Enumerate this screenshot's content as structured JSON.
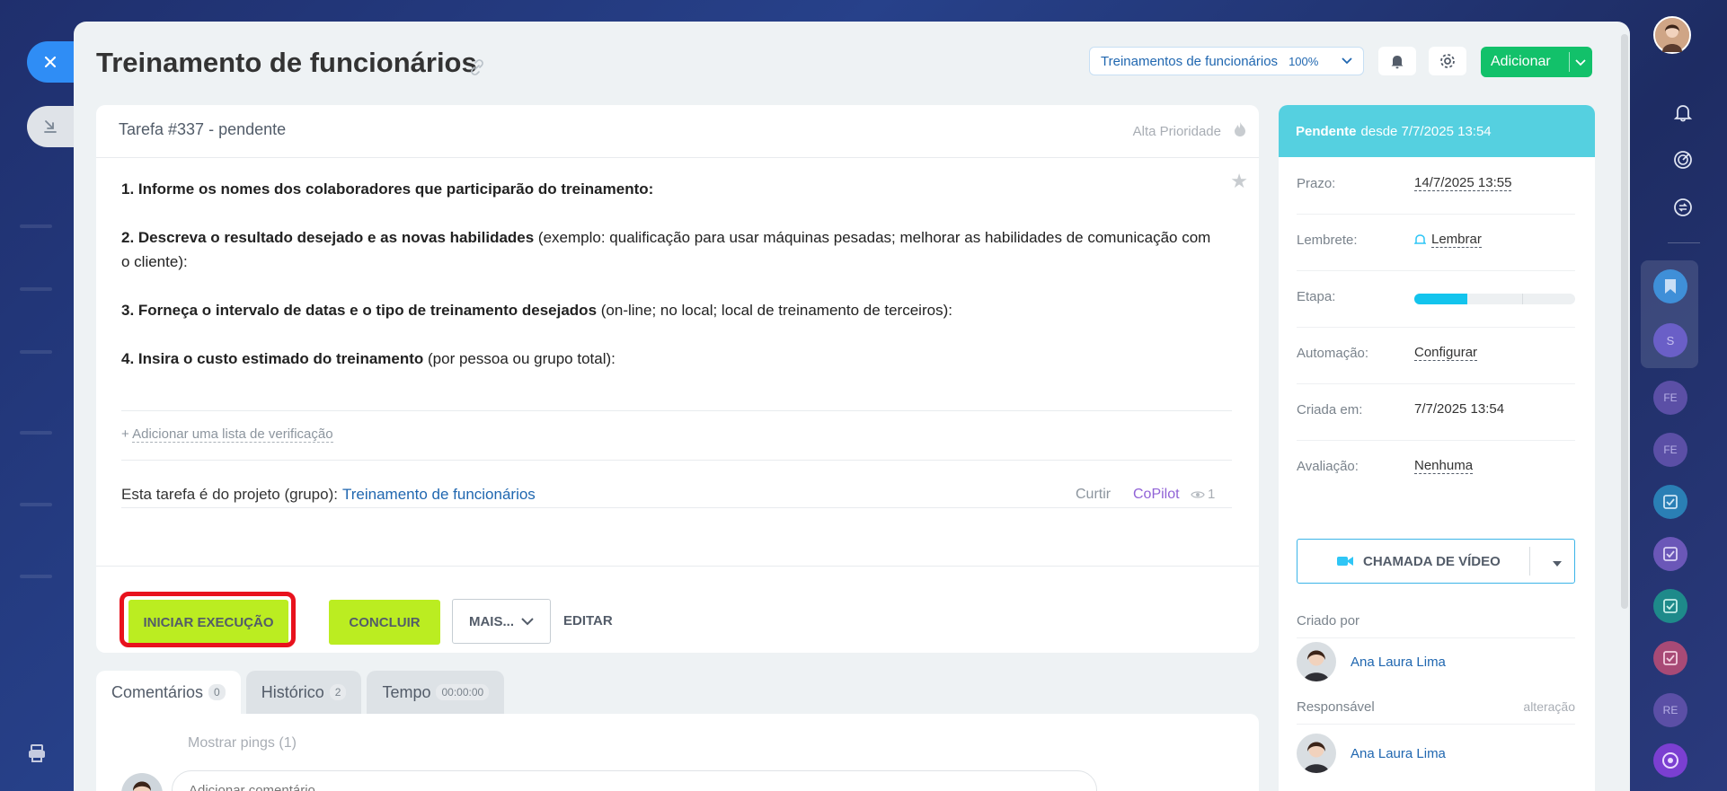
{
  "header": {
    "title": "Treinamento de funcionários",
    "project_select": {
      "name": "Treinamentos de funcionários",
      "percent": "100%"
    },
    "add_label": "Adicionar"
  },
  "task": {
    "number_status": "Tarefa #337 - pendente",
    "priority": "Alta Prioridade",
    "description": [
      {
        "bold": "1. Informe os nomes dos colaboradores que participarão do treinamento:",
        "rest": ""
      },
      {
        "bold": "2. Descreva o resultado desejado e as novas habilidades",
        "rest": " (exemplo: qualificação para usar máquinas pesadas; melhorar as habilidades de comunicação com o cliente):"
      },
      {
        "bold": "3. Forneça o intervalo de datas e o tipo de treinamento desejados",
        "rest": " (on-line; no local; local de treinamento de terceiros):"
      },
      {
        "bold": "4. Insira o custo estimado do treinamento",
        "rest": " (por pessoa ou grupo total):"
      }
    ],
    "checklist_prefix": "+",
    "checklist_add": "Adicionar uma lista de verificação",
    "project_prefix": "Esta tarefa é do projeto (grupo):",
    "project_link": "Treinamento de funcionários",
    "like": "Curtir",
    "copilot": "CoPilot",
    "views": "1"
  },
  "actions": {
    "start": "INICIAR EXECUÇÃO",
    "conclude": "CONCLUIR",
    "more": "MAIS...",
    "edit": "EDITAR"
  },
  "tabs": [
    {
      "label": "Comentários",
      "count": "0"
    },
    {
      "label": "Histórico",
      "count": "2"
    },
    {
      "label": "Tempo",
      "count": "00:00:00"
    }
  ],
  "comments": {
    "show_pings": "Mostrar pings (1)",
    "placeholder": "Adicionar comentário..."
  },
  "sidebar": {
    "status_label": "Pendente",
    "status_since": "desde 7/7/2025 13:54",
    "deadline_label": "Prazo:",
    "deadline_value": "14/7/2025 13:55",
    "reminder_label": "Lembrete:",
    "reminder_value": "Lembrar",
    "stage_label": "Etapa:",
    "stage_progress": 0.33,
    "automation_label": "Automação:",
    "automation_value": "Configurar",
    "created_label": "Criada em:",
    "created_value": "7/7/2025 13:54",
    "rating_label": "Avaliação:",
    "rating_value": "Nenhuma",
    "video_call": "CHAMADA DE VÍDEO",
    "created_by_label": "Criado por",
    "created_by_name": "Ana Laura Lima",
    "responsible_label": "Responsável",
    "responsible_change": "alteração",
    "responsible_name": "Ana Laura Lima"
  },
  "right_rail": {
    "avatars": [
      "S",
      "FE",
      "FE",
      "RE"
    ]
  },
  "colors": {
    "accent_green": "#bbed21",
    "add_green": "#12c16a",
    "status_cyan": "#55d0e0",
    "link_blue": "#2067b0",
    "highlight_red": "#e8121d"
  }
}
